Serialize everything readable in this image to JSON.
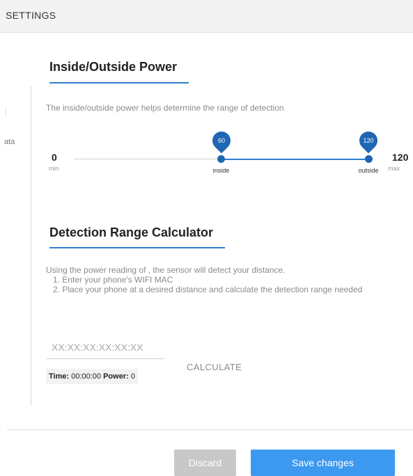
{
  "header": {
    "title": "SETTINGS"
  },
  "sidebar_fragment": {
    "text": "ata"
  },
  "power": {
    "title": "Inside/Outside Power",
    "description": "The inside/outside power helps determine the range of detection",
    "slider": {
      "min": 0,
      "max": 120,
      "min_value_text": "0",
      "max_value_text": "120",
      "min_label": "min",
      "max_label": "max",
      "inside": 60,
      "outside": 120,
      "inside_text": "60",
      "outside_text": "120",
      "inside_label": "inside",
      "outside_label": "outside"
    }
  },
  "calculator": {
    "title": "Detection Range Calculator",
    "intro": "Using the power reading of , the sensor will detect your distance.",
    "step1": "1. Enter your phone's WIFI MAC",
    "step2": "2. Place your phone at a desired distance and calculate the detection range needed",
    "mac_placeholder": "XX:XX:XX:XX:XX:XX",
    "time_label": "Time:",
    "time_value": "00:00:00",
    "power_label": "Power:",
    "power_value": "0",
    "calculate_label": "CALCULATE"
  },
  "footer": {
    "discard_label": "Discard",
    "save_label": "Save changes"
  },
  "colors": {
    "accent": "#2f7fd1",
    "thumb": "#1f66b3",
    "save_button": "#3d99f0",
    "discard_button": "#c8c8c8"
  }
}
